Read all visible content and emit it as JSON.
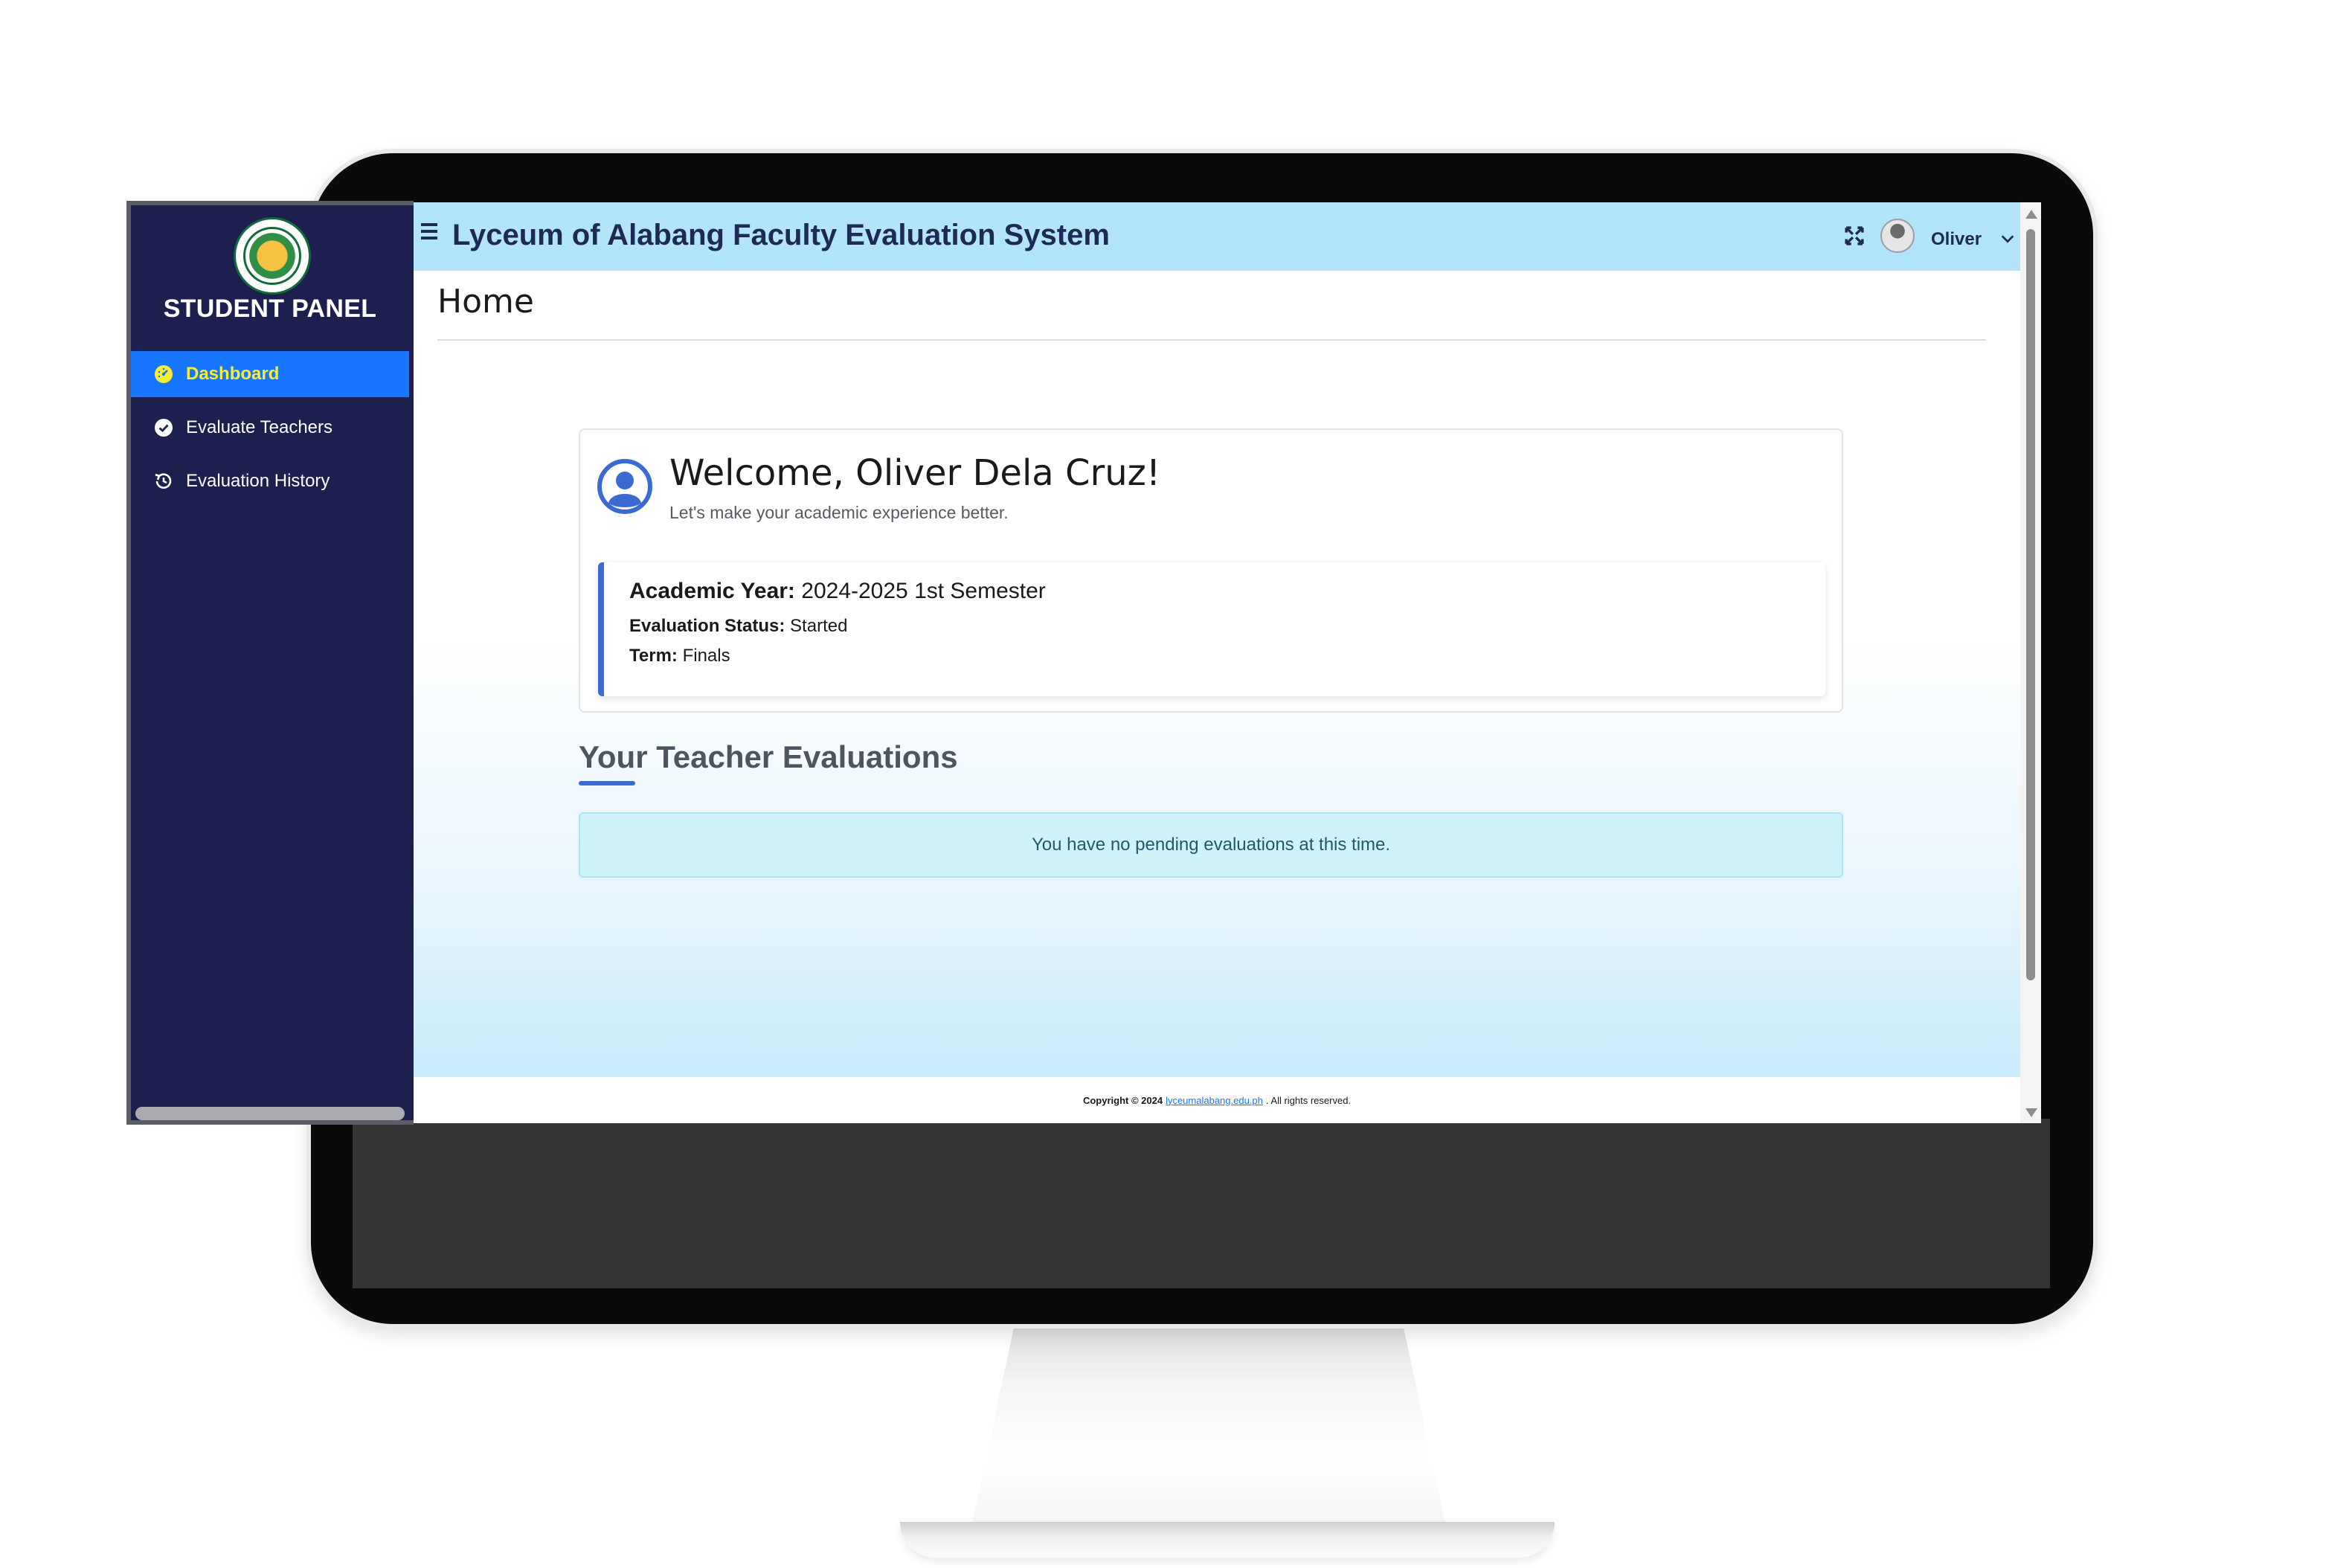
{
  "sidebar": {
    "panel_title": "STUDENT PANEL",
    "items": [
      {
        "label": "Dashboard",
        "icon": "dashboard-gauge-icon",
        "active": true
      },
      {
        "label": "Evaluate Teachers",
        "icon": "check-circle-icon",
        "active": false
      },
      {
        "label": "Evaluation History",
        "icon": "history-icon",
        "active": false
      }
    ],
    "active_color": "#1776ff",
    "active_text_color": "#f8ee2e",
    "background": "#1d1f4e"
  },
  "header": {
    "title": "Lyceum of Alabang Faculty Evaluation System",
    "user_name": "Oliver",
    "background": "#b2e4fb"
  },
  "page": {
    "title": "Home"
  },
  "welcome": {
    "heading": "Welcome, Oliver Dela Cruz!",
    "subtitle": "Let's make your academic experience better.",
    "academic_year_label": "Academic Year:",
    "academic_year_value": "2024-2025 1st Semester",
    "status_label": "Evaluation Status:",
    "status_value": "Started",
    "term_label": "Term:",
    "term_value": "Finals"
  },
  "evaluations": {
    "section_title": "Your Teacher Evaluations",
    "empty_message": "You have no pending evaluations at this time."
  },
  "footer": {
    "copyright": "Copyright © 2024",
    "link_text": "lyceumalabang.edu.ph",
    "rights": ". All rights reserved."
  }
}
